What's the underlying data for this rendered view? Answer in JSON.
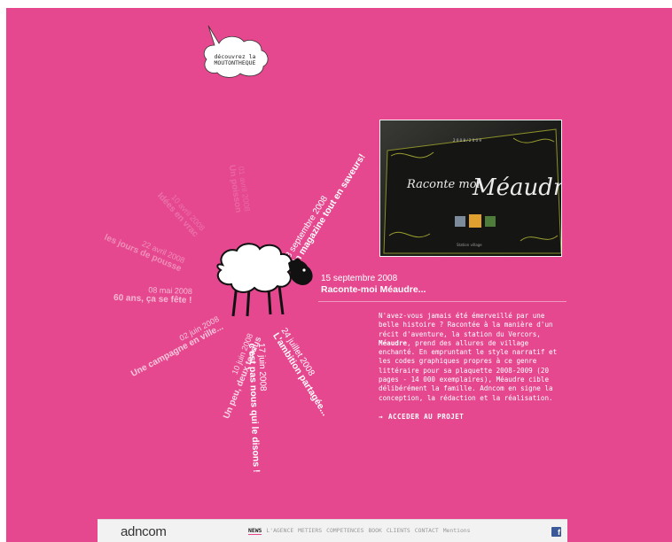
{
  "cloud": {
    "line1": "découvrez la",
    "line2": "MOUTONTHEQUE"
  },
  "radial_items": [
    {
      "date": "28 septembre 2008",
      "title": "Un magazine tout en saveurs!",
      "angle": -58,
      "r": 40,
      "strong": true,
      "opacity": 1.0
    },
    {
      "date": "24 juillet 2008",
      "title": "L'ambition partagée...",
      "angle": 58,
      "r": 50,
      "strong": true,
      "opacity": 1.0
    },
    {
      "date": "17 juin 2008",
      "title": "c'est pas nous qui le disons !",
      "angle": 88,
      "r": 60,
      "strong": true,
      "opacity": 1.0
    },
    {
      "date": "10 juin 2008",
      "title": "Un peu, deux tondus",
      "angle": 112,
      "r": 52,
      "strong": false,
      "opacity": 0.78
    },
    {
      "date": "02 juin 2008",
      "title": "Une campagne en ville...",
      "angle": 152,
      "r": 60,
      "strong": false,
      "opacity": 0.7
    },
    {
      "date": "08 mai 2008",
      "title": "60 ans, ça se fête !",
      "angle": 182,
      "r": 80,
      "strong": false,
      "opacity": 0.62
    },
    {
      "date": "22 avril 2008",
      "title": "les jours de pousse",
      "angle": 203,
      "r": 95,
      "strong": false,
      "opacity": 0.38
    },
    {
      "date": "10 avril 2008",
      "title": "Idées en vrac",
      "angle": 228,
      "r": 95,
      "strong": false,
      "opacity": 0.22
    },
    {
      "date": "01 avril 2008",
      "title": "Un poisson",
      "angle": 262,
      "r": 90,
      "strong": false,
      "opacity": 0.16
    }
  ],
  "photo": {
    "book_title": "Raconte-moi Méaudre",
    "subtitle": "Station village"
  },
  "active": {
    "date": "15 septembre 2008",
    "title": "Raconte-moi Méaudre..."
  },
  "description": {
    "before": "N'avez-vous jamais été émerveillé par une belle histoire ? Racontée à la manière d'un récit d'aventure, la station du Vercors, ",
    "bold": "Méaudre",
    "after": ", prend des allures de village enchanté. En empruntant le style narratif et les codes graphiques propres à ce genre littéraire pour sa plaquette 2008-2009 (20 pages - 14 000 exemplaires), Méaudre cible délibérément la famille. Adncom en signe la conception, la rédaction et la réalisation."
  },
  "cta": {
    "arrow": "→",
    "label": "ACCEDER AU PROJET"
  },
  "footer": {
    "logo_a": "adn",
    "logo_b": "com",
    "nav": [
      "NEWS",
      "L'AGENCE",
      "METIERS",
      "COMPETENCES",
      "BOOK",
      "CLIENTS",
      "CONTACT",
      "Mentions"
    ],
    "facebook": "f"
  },
  "colors": {
    "background": "#e5488f",
    "footer": "#f2f2f2",
    "facebook": "#3b5998"
  }
}
